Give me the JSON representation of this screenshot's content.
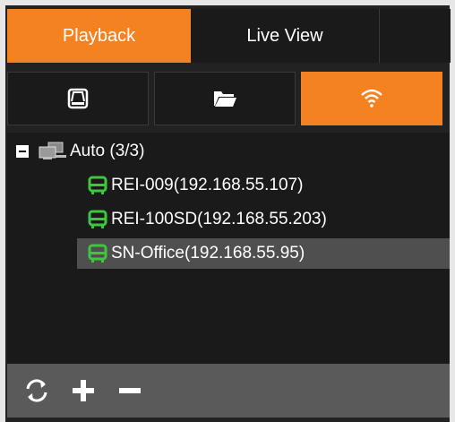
{
  "tabs": {
    "playback_label": "Playback",
    "live_view_label": "Live View",
    "active": "Playback"
  },
  "source_buttons": [
    {
      "icon": "drive-icon",
      "active": false
    },
    {
      "icon": "folder-icon",
      "active": false
    },
    {
      "icon": "wifi-icon",
      "active": true
    }
  ],
  "tree": {
    "root": {
      "label": "Auto (3/3)",
      "expanded": true,
      "icon": "network-computers-icon"
    },
    "devices": [
      {
        "label": "REI-009(192.168.55.107)",
        "icon": "bus-icon",
        "selected": false
      },
      {
        "label": "REI-100SD(192.168.55.203)",
        "icon": "bus-icon",
        "selected": false
      },
      {
        "label": "SN-Office(192.168.55.95)",
        "icon": "bus-icon",
        "selected": true
      }
    ]
  },
  "bottom_bar": {
    "buttons": [
      "refresh-icon",
      "add-icon",
      "remove-icon"
    ]
  },
  "colors": {
    "accent": "#f58220",
    "panel_bg": "#1a1a1a",
    "device_icon": "#3cc83c",
    "selected_row": "#4f4f4f"
  }
}
